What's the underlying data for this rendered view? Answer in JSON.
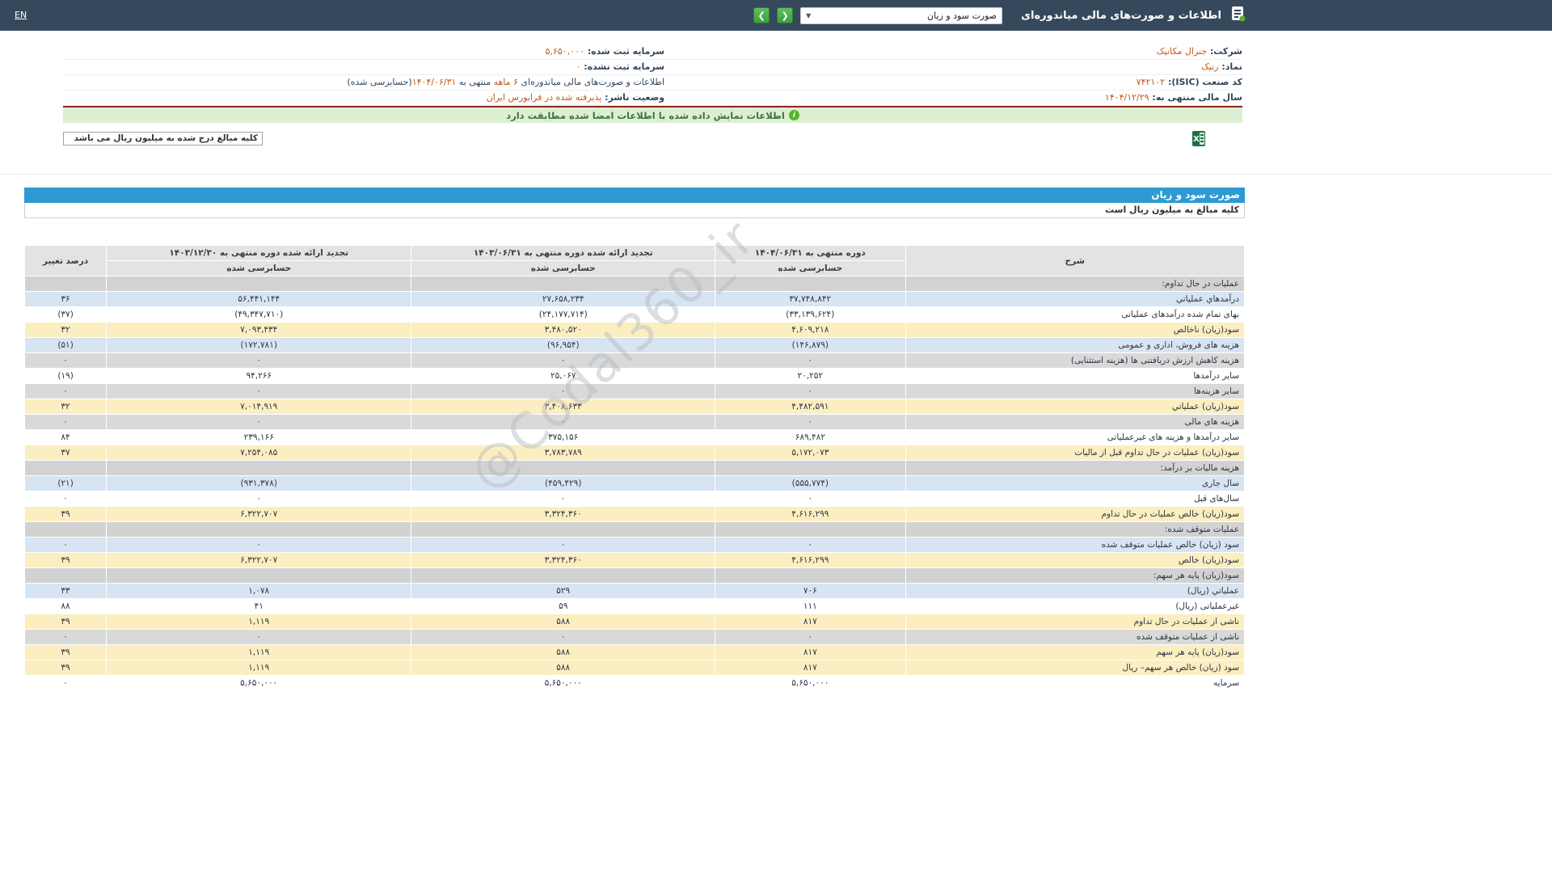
{
  "header": {
    "title": "اطلاعات و صورت‌های مالی میاندوره‌ای",
    "statement_select_value": "صورت سود و زیان",
    "next_label": "❯",
    "prev_label": "❮",
    "lang_label": "EN"
  },
  "company": {
    "right": [
      {
        "label": "شرکت:",
        "value": "جنرال مکانیک"
      },
      {
        "label": "نماد:",
        "value": "رنیک"
      },
      {
        "label": "کد صنعت (ISIC):",
        "value": "۷۴۲۱۰۲"
      },
      {
        "label": "سال مالی منتهی به:",
        "value": "۱۴۰۴/۱۲/۲۹"
      }
    ],
    "left": [
      {
        "label": "سرمایه ثبت شده:",
        "value": "۵,۶۵۰,۰۰۰"
      },
      {
        "label": "سرمایه ثبت نشده:",
        "value": "۰"
      },
      {
        "parts": [
          {
            "text": "اطلاعات و صورت‌های مالی میاندوره‌ای ",
            "highlight": false
          },
          {
            "text": "۶ ماهه",
            "highlight": true
          },
          {
            "text": " منتهی به ",
            "highlight": false
          },
          {
            "text": "۱۴۰۴/۰۶/۳۱",
            "highlight": true
          },
          {
            "text": "(حسابرسی شده)",
            "highlight": false
          }
        ]
      },
      {
        "label": "وضعیت ناشر:",
        "value": "پذیرفته شده در فرابورس ایران"
      }
    ]
  },
  "banner": {
    "text": "اطلاعات نمایش داده شده با اطلاعات امضا شده مطابقت دارد"
  },
  "units_box_text": "کلیه مبالغ درج شده به میلیون ریال می باشد",
  "excel_icon_label": "X",
  "watermark": "@Codal360_ir",
  "colors": {
    "topbar_bg": "#36495c",
    "title_bar_blue": "#2e9ad3",
    "negative_red": "#e50000",
    "company_value_orange": "#c2591d",
    "row_blue": "#d7e4f1",
    "row_yellow": "#fbeec1",
    "row_gray": "#d9d9d9",
    "banner_green_bg": "#ddefd2"
  },
  "statement": {
    "title": "صورت سود و زیان",
    "units_note": "کلیه مبالغ به میلیون ریال است",
    "table": {
      "headers": {
        "desc": "شرح",
        "p1": "دوره منتهی به ۱۴۰۴/۰۶/۳۱",
        "p2": "تجدید ارائه شده دوره منتهی به ۱۴۰۳/۰۶/۳۱",
        "p3": "تجدید ارائه شده دوره منتهی به ۱۴۰۳/۱۲/۳۰",
        "pct": "درصد تغییر",
        "audited": "حسابرسی شده"
      },
      "rows": [
        {
          "type": "section",
          "label": "عملیات در حال تداوم:"
        },
        {
          "type": "blue",
          "label": "درآمدهاي عملياتي",
          "v1": "۳۷,۷۴۸,۸۴۲",
          "v2": "۲۷,۶۵۸,۲۳۴",
          "v3": "۵۶,۴۴۱,۱۴۴",
          "pct": "۳۶"
        },
        {
          "type": "white",
          "label": "بهای تمام شده درآمدهای عملیاتی",
          "v1": "(۳۳,۱۳۹,۶۲۴)",
          "v2": "(۲۴,۱۷۷,۷۱۴)",
          "v3": "(۴۹,۳۴۷,۷۱۰)",
          "pct": "(۳۷)"
        },
        {
          "type": "yellow",
          "label": "سود(زيان) ناخالص",
          "v1": "۴,۶۰۹,۲۱۸",
          "v2": "۳,۴۸۰,۵۲۰",
          "v3": "۷,۰۹۳,۴۳۴",
          "pct": "۳۲"
        },
        {
          "type": "blue",
          "label": "هزینه های فروش، اداری و عمومی",
          "v1": "(۱۴۶,۸۷۹)",
          "v2": "(۹۶,۹۵۴)",
          "v3": "(۱۷۲,۷۸۱)",
          "pct": "(۵۱)"
        },
        {
          "type": "gray",
          "label": "هزینه کاهش ارزش دریافتنی ها (هزینه استثنایی)",
          "v1": "۰",
          "v2": "۰",
          "v3": "۰",
          "pct": "۰"
        },
        {
          "type": "white",
          "label": "سایر درآمدها",
          "v1": "۲۰,۲۵۲",
          "v2": "۲۵,۰۶۷",
          "v3": "۹۴,۲۶۶",
          "pct": "(۱۹)"
        },
        {
          "type": "gray",
          "label": "سایر هزینه‌ها",
          "v1": "۰",
          "v2": "۰",
          "v3": "۰",
          "pct": "۰"
        },
        {
          "type": "yellow",
          "label": "سود(زيان) عملياتي",
          "v1": "۴,۴۸۲,۵۹۱",
          "v2": "۳,۴۰۸,۶۳۳",
          "v3": "۷,۰۱۴,۹۱۹",
          "pct": "۳۲"
        },
        {
          "type": "gray",
          "label": "هزینه های مالی",
          "v1": "۰",
          "v2": "۰",
          "v3": "۰",
          "pct": "۰"
        },
        {
          "type": "white",
          "label": "سایر درآمدها و هزینه های غیرعملیاتی",
          "v1": "۶۸۹,۴۸۲",
          "v2": "۳۷۵,۱۵۶",
          "v3": "۲۳۹,۱۶۶",
          "pct": "۸۴"
        },
        {
          "type": "yellow",
          "label": "سود(زیان) عملیات در حال تداوم قبل از مالیات",
          "v1": "۵,۱۷۲,۰۷۳",
          "v2": "۳,۷۸۳,۷۸۹",
          "v3": "۷,۲۵۴,۰۸۵",
          "pct": "۳۷"
        },
        {
          "type": "section",
          "label": "هزینه مالیات بر درآمد:"
        },
        {
          "type": "blue",
          "label": "سال جاری",
          "v1": "(۵۵۵,۷۷۴)",
          "v2": "(۴۵۹,۴۲۹)",
          "v3": "(۹۳۱,۳۷۸)",
          "pct": "(۲۱)"
        },
        {
          "type": "white",
          "label": "سال‌های قبل",
          "v1": "۰",
          "v2": "۰",
          "v3": "۰",
          "pct": "۰"
        },
        {
          "type": "yellow",
          "label": "سود(زیان) خالص عملیات در حال تداوم",
          "v1": "۴,۶۱۶,۲۹۹",
          "v2": "۳,۳۲۴,۳۶۰",
          "v3": "۶,۳۲۲,۷۰۷",
          "pct": "۳۹"
        },
        {
          "type": "section",
          "label": "عملیات متوقف شده:"
        },
        {
          "type": "blue",
          "label": "سود (زیان) خالص عملیات متوقف شده",
          "v1": "۰",
          "v2": "۰",
          "v3": "۰",
          "pct": "۰"
        },
        {
          "type": "yellow",
          "label": "سود(زیان) خالص",
          "v1": "۴,۶۱۶,۲۹۹",
          "v2": "۳,۳۲۴,۳۶۰",
          "v3": "۶,۳۲۲,۷۰۷",
          "pct": "۳۹"
        },
        {
          "type": "section",
          "label": "سود(زیان) پایه هر سهم:"
        },
        {
          "type": "blue",
          "label": "عملیاتي (ریال)",
          "v1": "۷۰۶",
          "v2": "۵۲۹",
          "v3": "۱,۰۷۸",
          "pct": "۳۳"
        },
        {
          "type": "white",
          "label": "غیرعملیاتی (ریال)",
          "v1": "۱۱۱",
          "v2": "۵۹",
          "v3": "۴۱",
          "pct": "۸۸"
        },
        {
          "type": "yellow",
          "label": "ناشی از عملیات در حال تداوم",
          "v1": "۸۱۷",
          "v2": "۵۸۸",
          "v3": "۱,۱۱۹",
          "pct": "۳۹"
        },
        {
          "type": "gray",
          "label": "ناشی از عملیات متوقف شده",
          "v1": "۰",
          "v2": "۰",
          "v3": "۰",
          "pct": "۰"
        },
        {
          "type": "yellow",
          "label": "سود(زیان) پایه هر سهم",
          "v1": "۸۱۷",
          "v2": "۵۸۸",
          "v3": "۱,۱۱۹",
          "pct": "۳۹"
        },
        {
          "type": "yellow",
          "label": "سود (زیان) خالص هر سهم– ریال",
          "v1": "۸۱۷",
          "v2": "۵۸۸",
          "v3": "۱,۱۱۹",
          "pct": "۳۹"
        },
        {
          "type": "white",
          "label": "سرمایه",
          "v1": "۵,۶۵۰,۰۰۰",
          "v2": "۵,۶۵۰,۰۰۰",
          "v3": "۵,۶۵۰,۰۰۰",
          "pct": "۰"
        }
      ]
    }
  }
}
